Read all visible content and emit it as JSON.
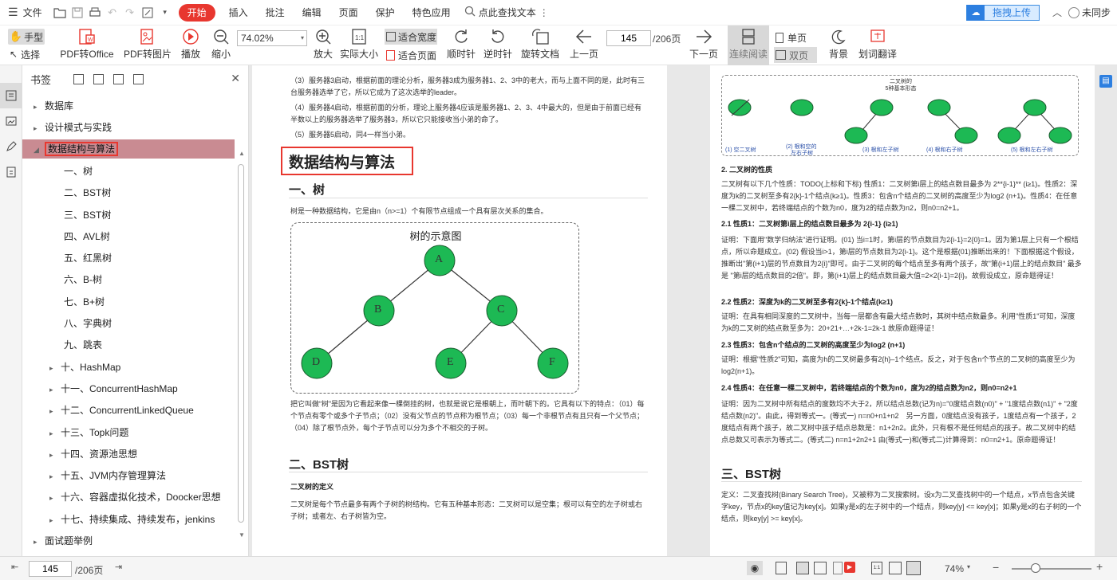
{
  "menu": {
    "file": "文件",
    "start": "开始",
    "insert": "插入",
    "annotate": "批注",
    "edit": "编辑",
    "page": "页面",
    "protect": "保护",
    "features": "特色应用",
    "search_placeholder": "点此查找文本",
    "upload": "拖拽上传",
    "login": "未同步"
  },
  "toolbar": {
    "hand": "手型",
    "select": "选择",
    "pdf_office": "PDF转Office",
    "pdf_image": "PDF转图片",
    "play": "播放",
    "zoom_out": "缩小",
    "zoom_value": "74.02%",
    "zoom_in": "放大",
    "actual_size": "实际大小",
    "fit_width": "适合宽度",
    "fit_page": "适合页面",
    "rotate_cw": "顺时针",
    "rotate_ccw": "逆时针",
    "rotate_doc": "旋转文档",
    "prev_page": "上一页",
    "page_current": "145",
    "page_total": "/206页",
    "next_page": "下一页",
    "continuous": "连续阅读",
    "single": "单页",
    "double": "双页",
    "background": "背景",
    "translate": "划词翻译"
  },
  "bookmarks": {
    "title": "书签",
    "items": [
      {
        "label": "数据库",
        "level": 0,
        "arrow": true
      },
      {
        "label": "设计模式与实践",
        "level": 0,
        "arrow": true
      },
      {
        "label": "数据结构与算法",
        "level": 0,
        "arrow": true,
        "selected": true
      },
      {
        "label": "一、树",
        "level": 1,
        "arrow": false
      },
      {
        "label": "二、BST树",
        "level": 1,
        "arrow": false
      },
      {
        "label": "三、BST树",
        "level": 1,
        "arrow": false
      },
      {
        "label": "四、AVL树",
        "level": 1,
        "arrow": false
      },
      {
        "label": "五、红黑树",
        "level": 1,
        "arrow": false
      },
      {
        "label": "六、B-树",
        "level": 1,
        "arrow": false
      },
      {
        "label": "七、B+树",
        "level": 1,
        "arrow": false
      },
      {
        "label": "八、字典树",
        "level": 1,
        "arrow": false
      },
      {
        "label": "九、跳表",
        "level": 1,
        "arrow": false
      },
      {
        "label": "十、HashMap",
        "level": 1,
        "arrow": true
      },
      {
        "label": "十一、ConcurrentHashMap",
        "level": 1,
        "arrow": true
      },
      {
        "label": "十二、ConcurrentLinkedQueue",
        "level": 1,
        "arrow": true
      },
      {
        "label": "十三、Topk问题",
        "level": 1,
        "arrow": true
      },
      {
        "label": "十四、资源池思想",
        "level": 1,
        "arrow": true
      },
      {
        "label": "十五、JVM内存管理算法",
        "level": 1,
        "arrow": true
      },
      {
        "label": "十六、容器虚拟化技术，Doocker思想",
        "level": 1,
        "arrow": true
      },
      {
        "label": "十七、持续集成、持续发布，jenkins",
        "level": 1,
        "arrow": true
      },
      {
        "label": "面试题举例",
        "level": 0,
        "arrow": true
      }
    ]
  },
  "page1": {
    "p1": "（3）服务器3启动，根据前面的理论分析，服务器3成为服务器1、2、3中的老大，而与上面不同的是，此时有三台服务器选举了它，所以它成为了这次选举的leader。",
    "p2": "（4）服务器4启动，根据前面的分析，理论上服务器4应该是服务器1、2、3、4中最大的，但是由于前面已经有半数以上的服务器选举了服务器3，所以它只能接收当小弟的命了。",
    "p3": "（5）服务器5启动，同4一样当小弟。",
    "title": "数据结构与算法",
    "sec1": "一、树",
    "sec1_desc": "树是一种数据结构，它是由n（n>=1）个有限节点组成一个具有层次关系的集合。",
    "diagram_title": "树的示意图",
    "nodes": [
      "A",
      "B",
      "C",
      "D",
      "E",
      "F"
    ],
    "para_tree": "把它叫做“树”是因为它看起来像一棵倒挂的树，也就是说它是根朝上，而叶朝下的。它具有以下的特点：（01）每个节点有零个或多个子节点；（02）没有父节点的节点称为根节点；（03）每一个非根节点有且只有一个父节点；（04）除了根节点外，每个子节点可以分为多个不相交的子树。",
    "sec2": "二、BST树",
    "sub_def": "二叉树的定义",
    "para_bin": "二叉树是每个节点最多有两个子树的树结构。它有五种基本形态：二叉树可以是空集；根可以有空的左子树或右子树；或者左、右子树皆为空。"
  },
  "page2": {
    "diag_title": "二叉树的",
    "diag_subtitle": "5种基本形态",
    "forms": [
      "(1) 空二叉树",
      "(2) 根和空的",
      "左右子树",
      "(3) 根和左子树",
      "(4) 根和右子树",
      "(5) 根和左右子树"
    ],
    "sec_prop": "2. 二叉树的性质",
    "para_prop": "二叉树有以下几个性质：TODO(上标和下标) 性质1：二叉树第i层上的结点数目最多为 2**{i-1}** (i≥1)。性质2：深度为k的二叉树至多有2{k}-1个结点(k≥1)。性质3：包含n个结点的二叉树的高度至少为log2 (n+1)。性质4：在任意一棵二叉树中，若终端结点的个数为n0，度为2的结点数为n2，则n0=n2+1。",
    "h21": "2.1 性质1：二叉树第i层上的结点数目最多为 2{i-1} (i≥1)",
    "p21": "证明：下面用\"数学归纳法\"进行证明。(01) 当i=1时，第i层的节点数目为2{i-1}=2{0}=1。因为第1层上只有一个根结点，所以命题成立。(02) 假设当i>1，第i层的节点数目为2{i-1}。这个是根据(01)推断出来的！下面根据这个假设，推断出\"第(i+1)层的节点数目为2{i}\"即可。由于二叉树的每个结点至多有两个孩子，故\"第(i+1)层上的结点数目\" 最多是 \"第i层的结点数目的2倍\"。即，第(i+1)层上的结点数目最大值=2×2{i-1}=2{i}。故假设成立，原命题得证！",
    "h22": "2.2 性质2：深度为k的二叉树至多有2{k}-1个结点(k≥1)",
    "p22": "证明：在具有相同深度的二叉树中，当每一层都含有最大结点数时，其树中结点数最多。利用\"性质1\"可知，深度为k的二叉树的结点数至多为：20+21+…+2k-1=2k-1 故原命题得证！",
    "h23": "2.3 性质3：包含n个结点的二叉树的高度至少为log2 (n+1)",
    "p23": "证明：根据\"性质2\"可知，高度为h的二叉树最多有2{h}–1个结点。反之，对于包含n个节点的二叉树的高度至少为log2(n+1)。",
    "h24": "2.4 性质4：在任意一棵二叉树中，若终端结点的个数为n0，度为2的结点数为n2，则n0=n2+1",
    "p24": "证明：因为二叉树中所有结点的度数均不大于2，所以结点总数(记为n)=\"0度结点数(n0)\" + \"1度结点数(n1)\" + \"2度结点数(n2)\"。由此，得到等式一。(等式一) n=n0+n1+n2　另一方面，0度结点没有孩子，1度结点有一个孩子，2度结点有两个孩子，故二叉树中孩子结点总数是：n1+2n2。此外，只有根不是任何结点的孩子。故二叉树中的结点总数又可表示为等式二。(等式二) n=n1+2n2+1 由(等式一)和(等式二)计算得到：n0=n2+1。原命题得证！",
    "sec3": "三、BST树",
    "p3": "定义：二叉查找树(Binary Search Tree)，又被称为二叉搜索树。设x为二叉查找树中的一个结点，x节点包含关键字key，节点x的key值记为key[x]。如果y是x的左子树中的一个结点，则key[y] <= key[x]；如果y是x的右子树的一个结点，则key[y] >= key[x]。"
  },
  "status": {
    "page_current": "145",
    "page_total": "/206页",
    "zoom": "74%"
  },
  "colors": {
    "accent": "#e8372f",
    "node": "#1db954",
    "selected_bg": "#c98b92",
    "highlight_box": "#e8372f"
  }
}
